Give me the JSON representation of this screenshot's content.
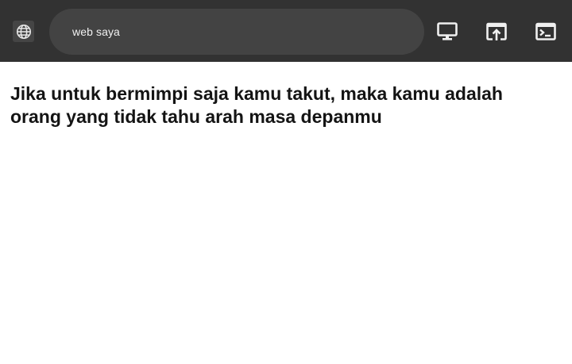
{
  "toolbar": {
    "site_icon": "globe-icon",
    "url": "web saya",
    "actions": [
      {
        "name": "desktop-view-button",
        "icon": "desktop-icon"
      },
      {
        "name": "open-in-new-button",
        "icon": "open-in-new-icon"
      },
      {
        "name": "console-button",
        "icon": "terminal-icon"
      }
    ],
    "background_color": "#323232",
    "url_bar_color": "#434343"
  },
  "page": {
    "quote": "Jika untuk bermimpi saja kamu takut, maka kamu adalah orang yang tidak tahu arah masa depanmu"
  }
}
